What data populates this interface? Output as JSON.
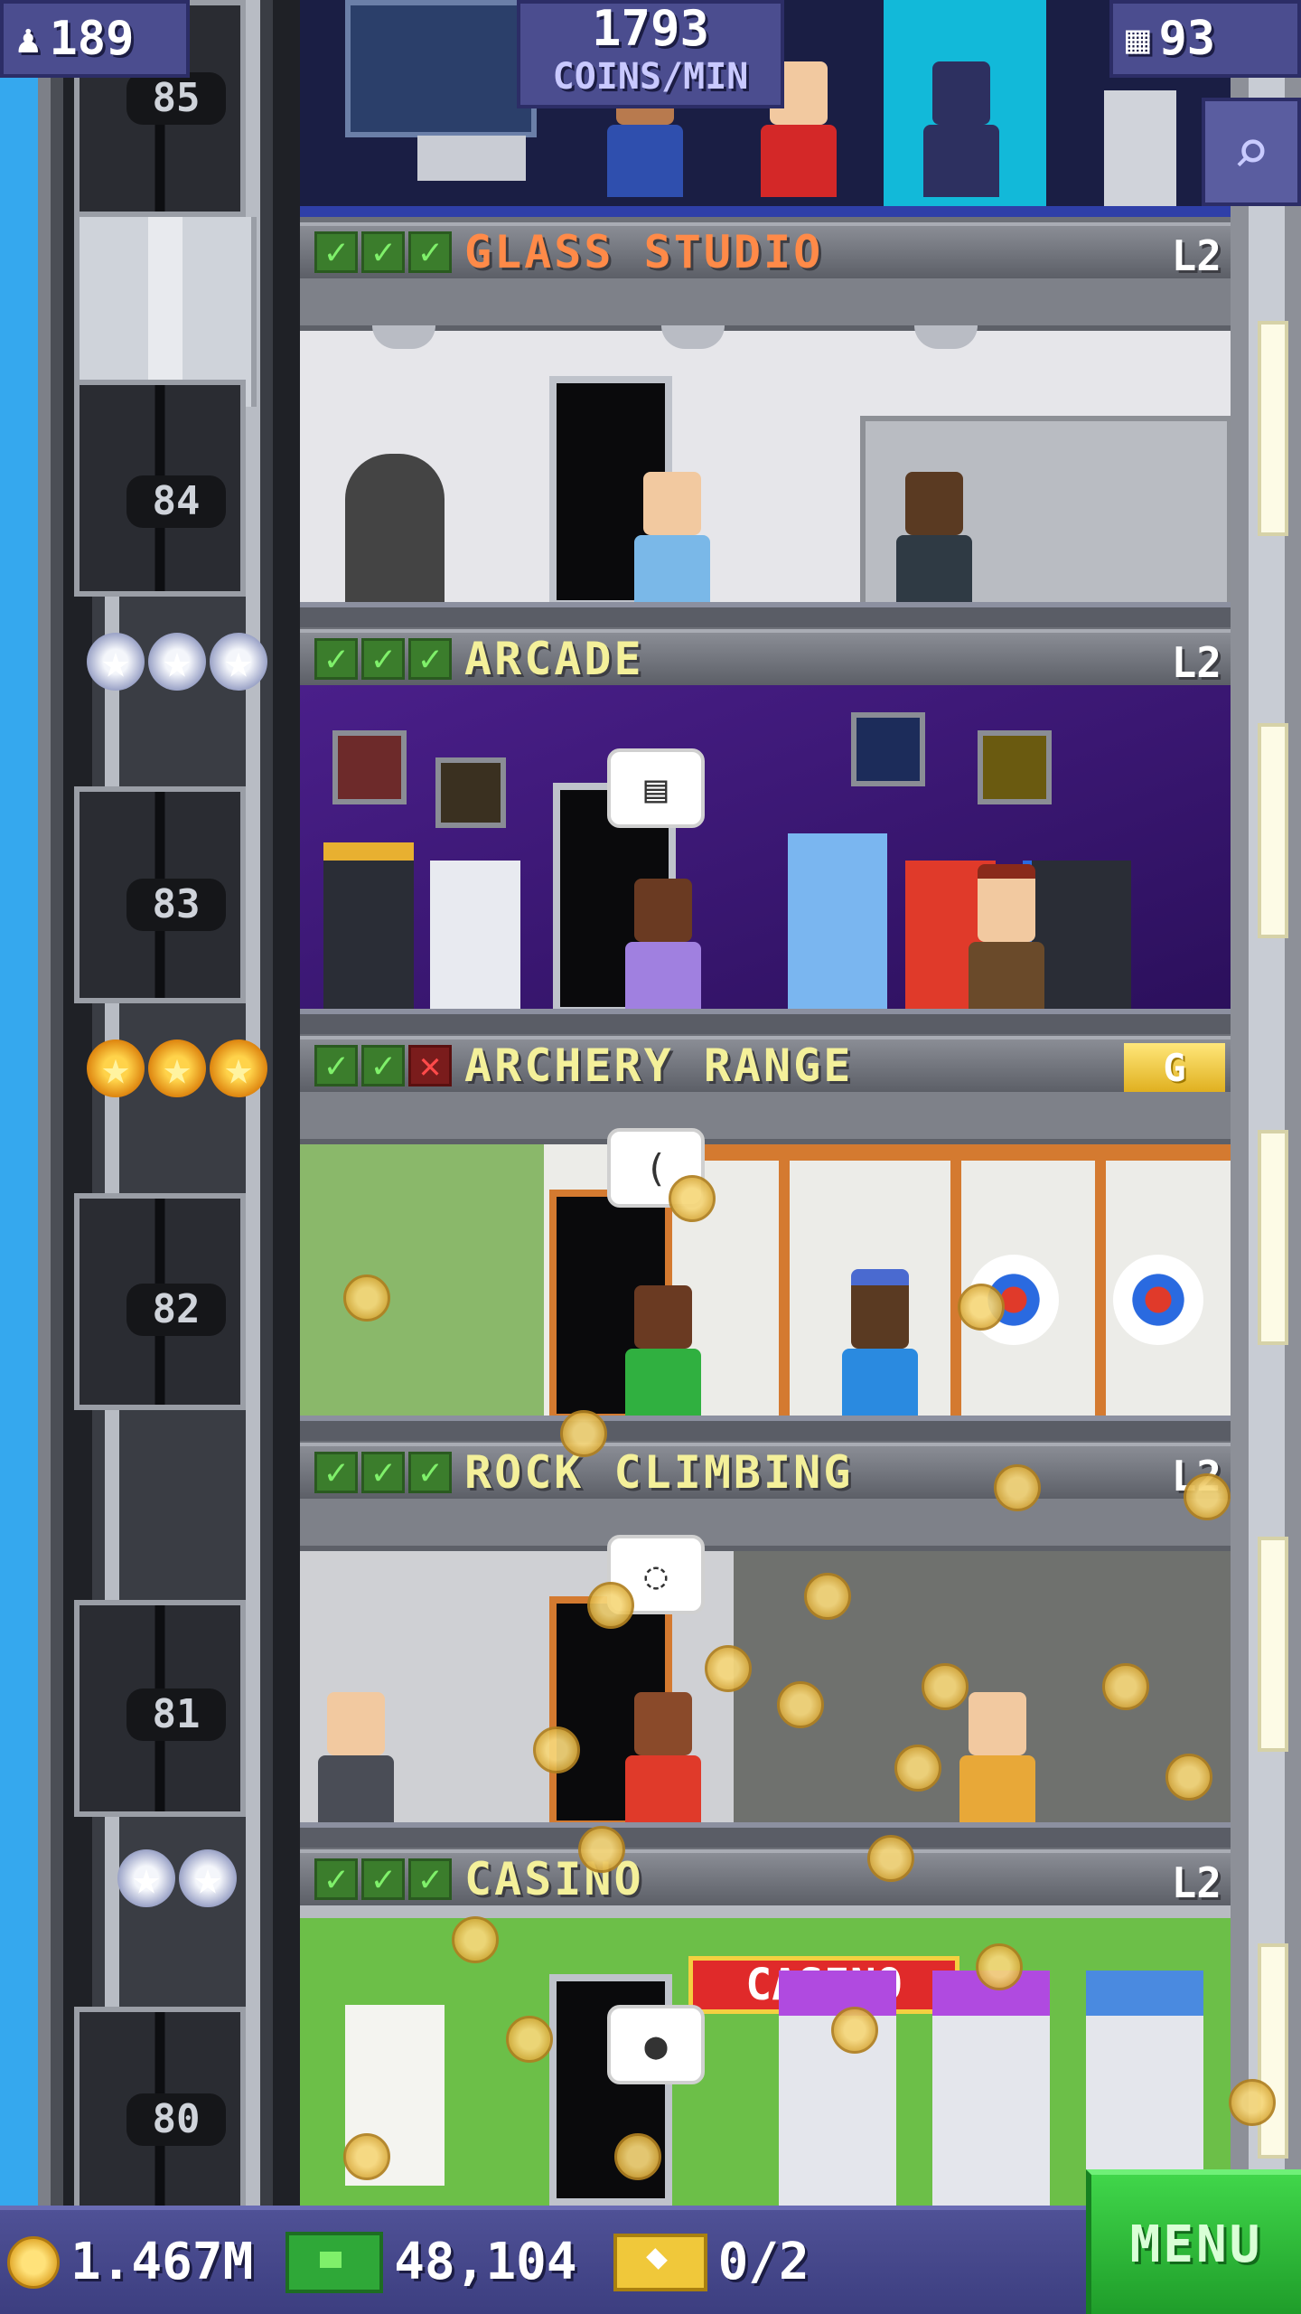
{
  "hud": {
    "population": "189",
    "coins_per_min_value": "1793",
    "coins_per_min_label": "COINS/MIN",
    "floors_count": "93"
  },
  "elevator": {
    "floor_numbers": [
      "85",
      "84",
      "83",
      "82",
      "81",
      "80"
    ]
  },
  "floors": [
    {
      "name": "GLASS STUDIO",
      "level": "L2",
      "checks": [
        true,
        true,
        true
      ],
      "name_color": "orange"
    },
    {
      "name": "ARCADE",
      "level": "L2",
      "checks": [
        true,
        true,
        true
      ]
    },
    {
      "name": "ARCHERY RANGE",
      "level": "",
      "badge": "G",
      "checks": [
        true,
        true,
        false
      ]
    },
    {
      "name": "ROCK CLIMBING",
      "level": "L2",
      "checks": [
        true,
        true,
        true
      ]
    },
    {
      "name": "CASINO",
      "level": "L2",
      "checks": [
        true,
        true,
        true
      ]
    }
  ],
  "casino_sign": "CASINO",
  "bottom": {
    "coins": "1.467M",
    "bux": "48,104",
    "tickets": "0/2",
    "menu_label": "MENU"
  },
  "colors": {
    "sky": "#35a8ee",
    "hud_panel": "#4b4d8f",
    "menu_green": "#2fbf3a",
    "floor_name_yellow": "#f4f09a",
    "floor_name_orange": "#ff8a48"
  },
  "icons": {
    "population": "person-icon",
    "floors": "building-icon",
    "search": "magnifier-icon",
    "coins": "coin-icon",
    "bux": "bux-cash-icon",
    "tickets": "ticket-icon",
    "check": "check-icon",
    "cross": "cross-icon",
    "star": "star-icon"
  }
}
